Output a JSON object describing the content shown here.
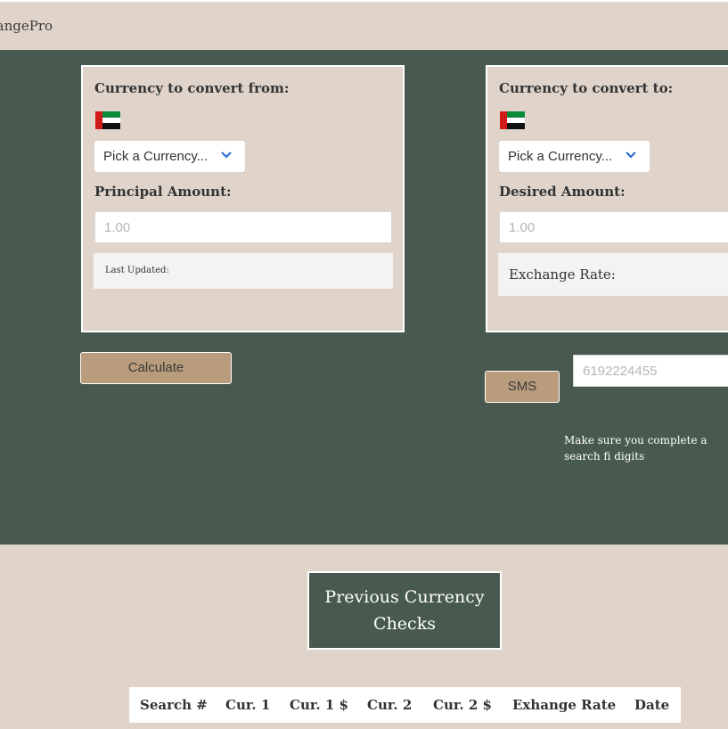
{
  "navbar": {
    "brand": "hangePro"
  },
  "from_card": {
    "title": "Currency to convert from:",
    "flag_icon": "uae-flag-icon",
    "select_value": "Pick a Currency...",
    "amount_label": "Principal Amount:",
    "amount_placeholder": "1.00",
    "last_updated_label": "Last Updated:"
  },
  "to_card": {
    "title": "Currency to convert to:",
    "flag_icon": "uae-flag-icon",
    "select_value": "Pick a Currency...",
    "amount_label": "Desired Amount:",
    "amount_placeholder": "1.00",
    "exchange_rate_label": "Exchange Rate:"
  },
  "actions": {
    "calculate_label": "Calculate",
    "sms_label": "SMS",
    "phone_placeholder": "6192224455",
    "sms_hint": "Make sure you complete a search fi digits"
  },
  "history": {
    "title": "Previous Currency Checks",
    "columns": [
      "Search #",
      "Cur. 1",
      "Cur. 1 $",
      "Cur. 2",
      "Cur. 2 $",
      "Exhange Rate",
      "Date"
    ]
  },
  "colors": {
    "background": "#e0d4ca",
    "panel": "#485a4f",
    "button": "#b89c7b",
    "chevron": "#2f6fd0"
  }
}
